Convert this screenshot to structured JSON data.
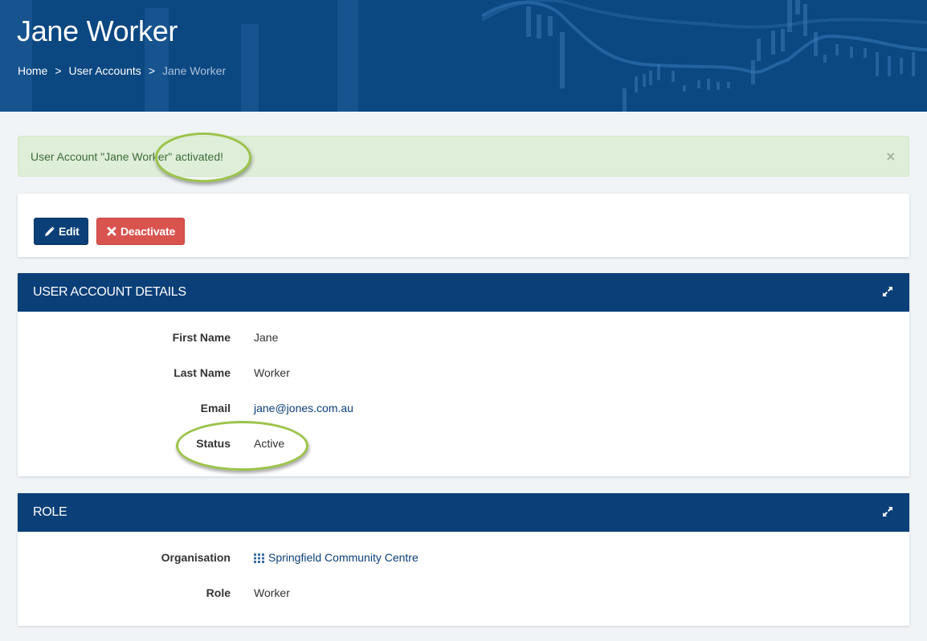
{
  "header": {
    "title": "Jane Worker",
    "breadcrumb": [
      {
        "label": "Home"
      },
      {
        "label": "User Accounts"
      },
      {
        "label": "Jane Worker"
      }
    ],
    "separator": ">"
  },
  "alert": {
    "message": "User Account \"Jane Worker\" activated!",
    "close_label": "×"
  },
  "actions": {
    "edit_label": "Edit",
    "edit_icon": "pencil-icon",
    "deactivate_label": "Deactivate",
    "deactivate_icon": "x-icon"
  },
  "panels": {
    "details": {
      "title": "USER ACCOUNT DETAILS",
      "rows": [
        {
          "label": "First Name",
          "value": "Jane"
        },
        {
          "label": "Last Name",
          "value": "Worker"
        },
        {
          "label": "Email",
          "value": "jane@jones.com.au"
        },
        {
          "label": "Status",
          "value": "Active"
        }
      ]
    },
    "role": {
      "title": "ROLE",
      "rows": [
        {
          "label": "Organisation",
          "value": "Springfield Community Centre",
          "icon": "grid-icon"
        },
        {
          "label": "Role",
          "value": "Worker"
        }
      ]
    }
  },
  "colors": {
    "brand": "#0b3f78",
    "danger": "#d9534f",
    "success_bg": "#dfeed8",
    "highlight_ring": "#9bc34a"
  }
}
